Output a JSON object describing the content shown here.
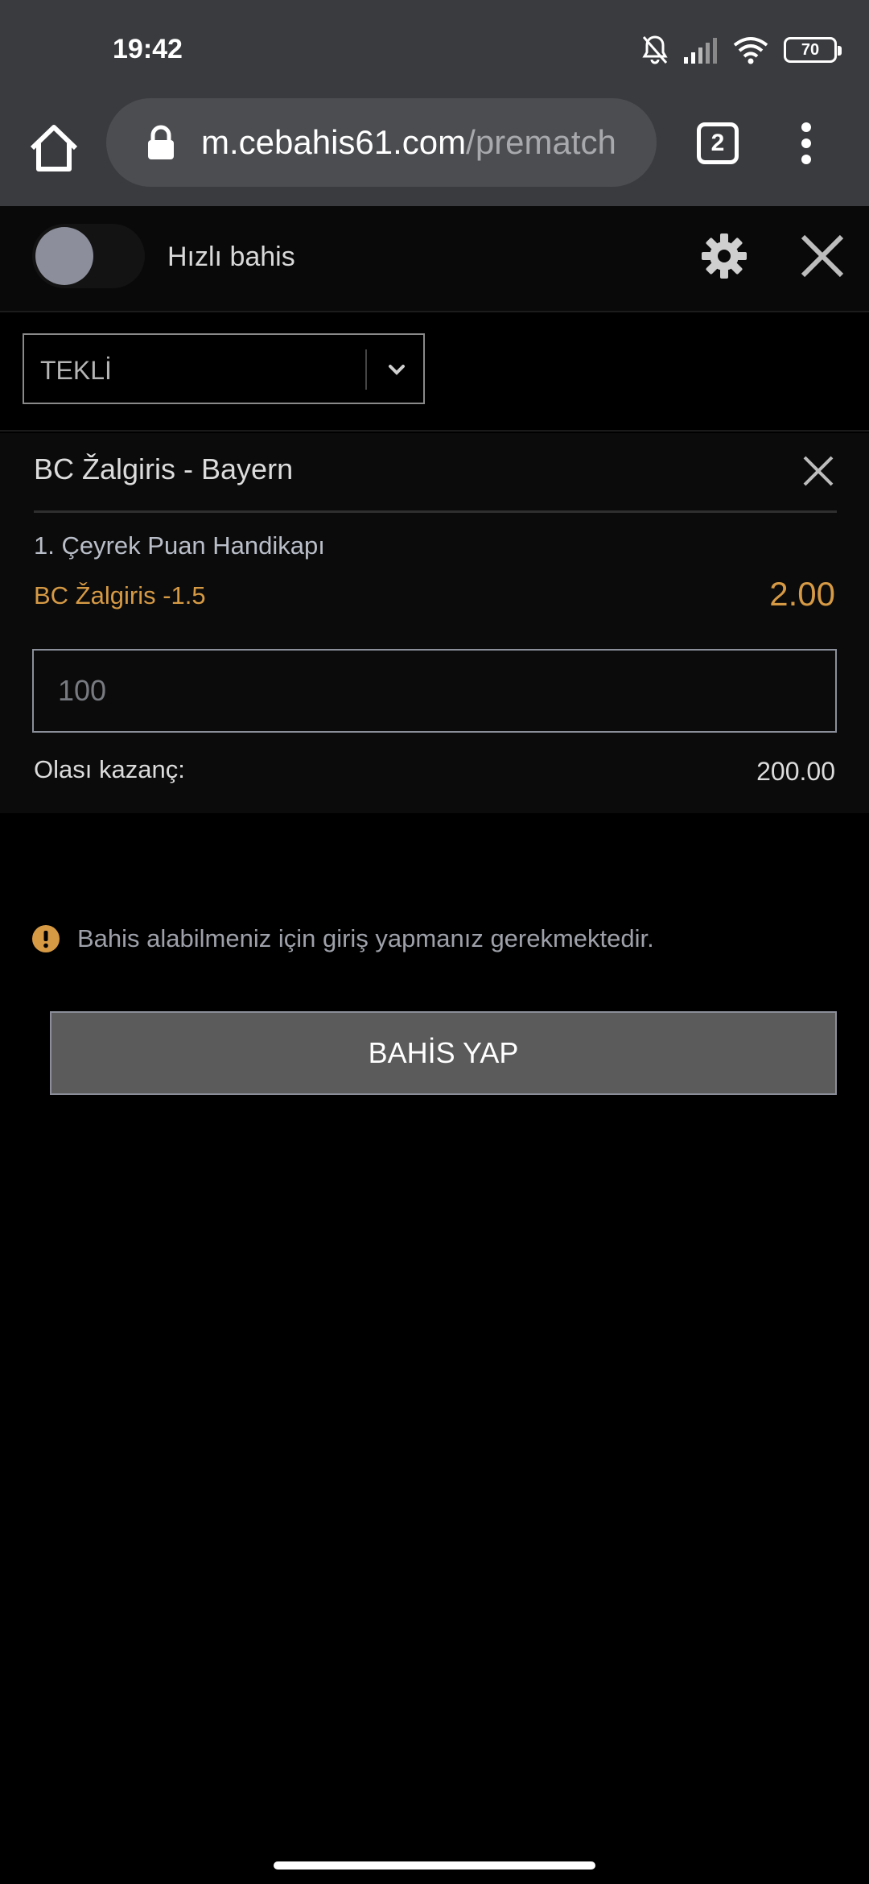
{
  "status_bar": {
    "time": "19:42",
    "battery": "70",
    "icons": [
      "bell-off-icon",
      "signal-icon",
      "wifi-icon",
      "battery-icon"
    ]
  },
  "browser": {
    "url_host": "m.cebahis61.com",
    "url_path": "/prematch",
    "tab_count": "2"
  },
  "betslip": {
    "quick_bet_label": "Hızlı bahis",
    "quick_bet_enabled": false,
    "bet_type": "TEKLİ",
    "match": "BC Žalgiris - Bayern",
    "market": "1. Çeyrek Puan Handikapı",
    "selection": "BC Žalgiris -1.5",
    "odds": "2.00",
    "stake_placeholder": "100",
    "possible_win_label": "Olası kazanç:",
    "possible_win_value": "200.00",
    "login_warning": "Bahis alabilmeniz için giriş yapmanız gerekmektedir.",
    "place_bet_label": "BAHİS YAP",
    "accent_color": "#d69a45"
  }
}
